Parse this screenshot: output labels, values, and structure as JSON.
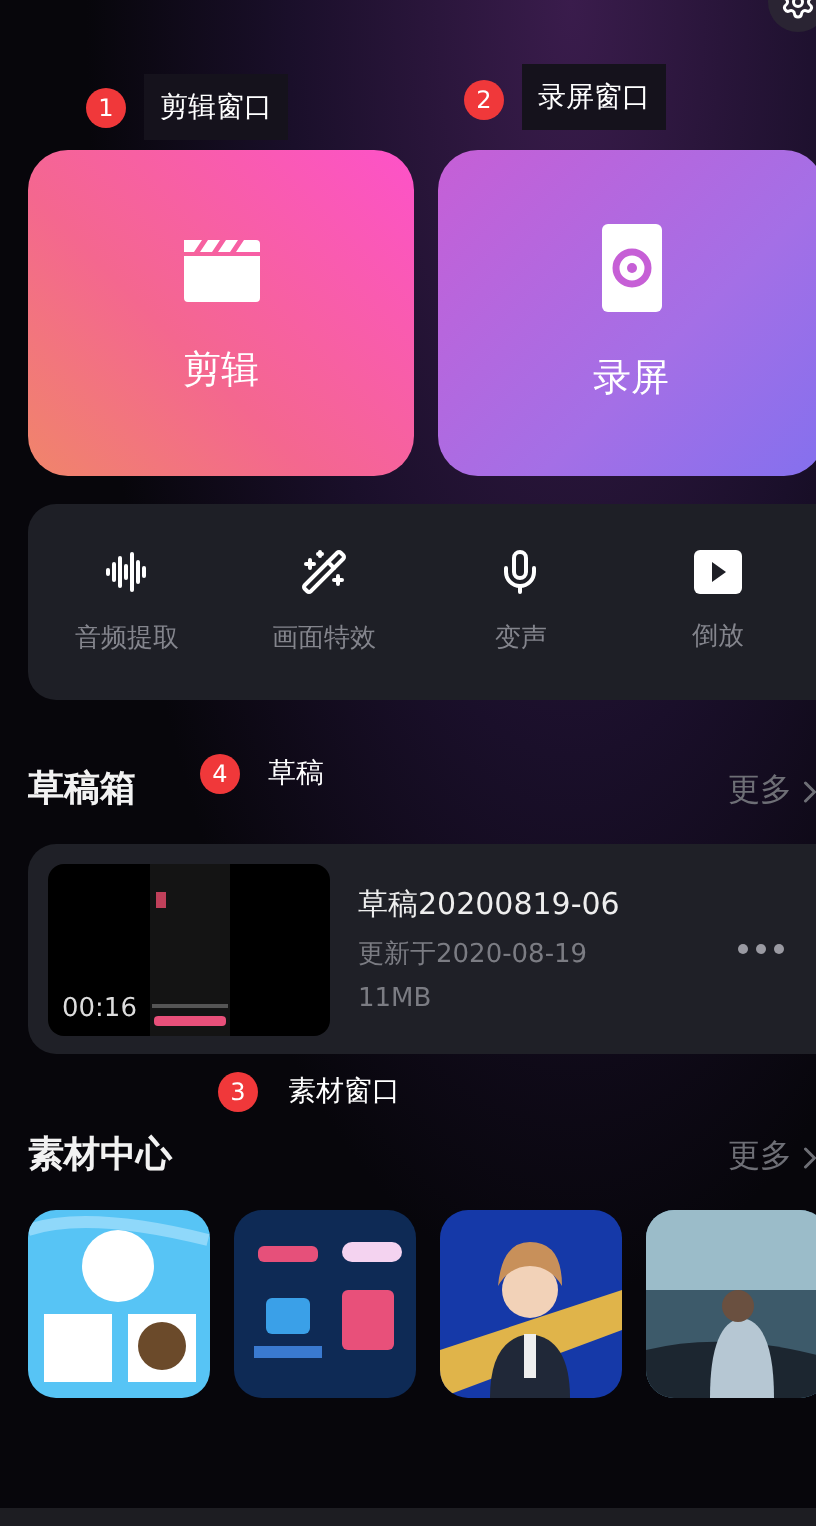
{
  "main_actions": [
    {
      "kind": "edit",
      "label": "剪辑",
      "annotation": {
        "number": "1",
        "text": "剪辑窗口"
      }
    },
    {
      "kind": "record",
      "label": "录屏",
      "annotation": {
        "number": "2",
        "text": "录屏窗口"
      }
    }
  ],
  "tools": [
    {
      "kind": "audio",
      "label": "音频提取"
    },
    {
      "kind": "effect",
      "label": "画面特效"
    },
    {
      "kind": "voice",
      "label": "变声"
    },
    {
      "kind": "reverse",
      "label": "倒放"
    }
  ],
  "drafts": {
    "title": "草稿箱",
    "more": "更多",
    "annotation": {
      "number": "4",
      "text": "草稿"
    },
    "items": [
      {
        "name": "草稿20200819-06",
        "updated": "更新于2020-08-19",
        "size": "11MB",
        "duration": "00:16"
      }
    ]
  },
  "materials": {
    "title": "素材中心",
    "more": "更多",
    "annotation": {
      "number": "3",
      "text": "素材窗口"
    }
  }
}
